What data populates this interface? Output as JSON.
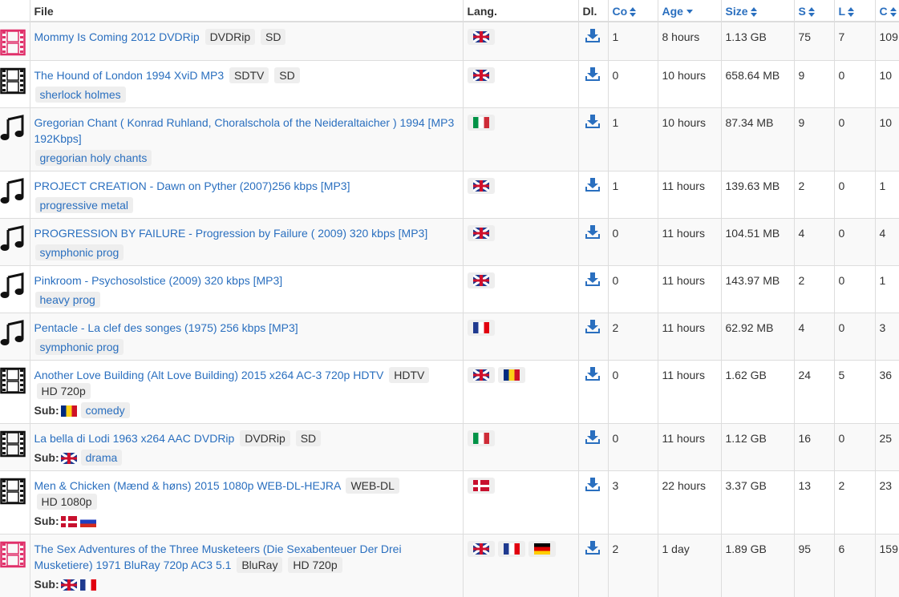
{
  "header": {
    "file": "File",
    "lang": "Lang.",
    "dl": "Dl.",
    "co": "Co",
    "age": "Age",
    "size": "Size",
    "s": "S",
    "l": "L",
    "c": "C"
  },
  "colors": {
    "link": "#2a6fbf",
    "accent_pink": "#e0306a",
    "border": "#dddddd",
    "badge": "#eeeeee"
  },
  "rows": [
    {
      "type": "film-pink",
      "title": "Mommy Is Coming 2012 DVDRip",
      "badges": [
        "DVDRip",
        "SD"
      ],
      "tags": [],
      "sub": [],
      "langs": [
        "uk"
      ],
      "co": "1",
      "age": "8 hours",
      "size": "1.13 GB",
      "s": "75",
      "l": "7",
      "c": "109"
    },
    {
      "type": "film",
      "title": "The Hound of London 1994 XviD MP3",
      "badges": [
        "SDTV",
        "SD"
      ],
      "tags": [
        "sherlock holmes"
      ],
      "sub": [],
      "langs": [
        "uk"
      ],
      "co": "0",
      "age": "10 hours",
      "size": "658.64 MB",
      "s": "9",
      "l": "0",
      "c": "10"
    },
    {
      "type": "music",
      "title": "Gregorian Chant ( Konrad Ruhland, Choralschola of the Neideraltaicher ) 1994 [MP3 192Kbps]",
      "badges": [],
      "tags": [
        "gregorian holy chants"
      ],
      "sub": [],
      "langs": [
        "it"
      ],
      "co": "1",
      "age": "10 hours",
      "size": "87.34 MB",
      "s": "9",
      "l": "0",
      "c": "10"
    },
    {
      "type": "music",
      "title": "PROJECT CREATION - Dawn on Pyther (2007)256 kbps [MP3]",
      "badges": [],
      "tags": [
        "progressive metal"
      ],
      "sub": [],
      "langs": [
        "uk"
      ],
      "co": "1",
      "age": "11 hours",
      "size": "139.63 MB",
      "s": "2",
      "l": "0",
      "c": "1"
    },
    {
      "type": "music",
      "title": "PROGRESSION BY FAILURE - Progression by Failure ( 2009) 320 kbps [MP3]",
      "badges": [],
      "tags": [
        "symphonic prog"
      ],
      "sub": [],
      "langs": [
        "uk"
      ],
      "co": "0",
      "age": "11 hours",
      "size": "104.51 MB",
      "s": "4",
      "l": "0",
      "c": "4"
    },
    {
      "type": "music",
      "title": "Pinkroom - Psychosolstice (2009) 320 kbps [MP3]",
      "badges": [],
      "tags": [
        "heavy prog"
      ],
      "sub": [],
      "langs": [
        "uk"
      ],
      "co": "0",
      "age": "11 hours",
      "size": "143.97 MB",
      "s": "2",
      "l": "0",
      "c": "1"
    },
    {
      "type": "music",
      "title": "Pentacle - La clef des songes (1975) 256 kbps [MP3]",
      "badges": [],
      "tags": [
        "symphonic prog"
      ],
      "sub": [],
      "langs": [
        "fr"
      ],
      "co": "2",
      "age": "11 hours",
      "size": "62.92 MB",
      "s": "4",
      "l": "0",
      "c": "3"
    },
    {
      "type": "film",
      "title": "Another Love Building (Alt Love Building) 2015 x264 AC-3 720p HDTV",
      "badges": [
        "HDTV",
        "HD 720p"
      ],
      "tags": [
        "comedy"
      ],
      "sub": [
        "ro"
      ],
      "langs": [
        "uk",
        "ro"
      ],
      "co": "0",
      "age": "11 hours",
      "size": "1.62 GB",
      "s": "24",
      "l": "5",
      "c": "36"
    },
    {
      "type": "film",
      "title": "La bella di Lodi 1963 x264 AAC DVDRip",
      "badges": [
        "DVDRip",
        "SD"
      ],
      "tags": [
        "drama"
      ],
      "sub": [
        "uk"
      ],
      "langs": [
        "it"
      ],
      "co": "0",
      "age": "11 hours",
      "size": "1.12 GB",
      "s": "16",
      "l": "0",
      "c": "25"
    },
    {
      "type": "film",
      "title": "Men & Chicken (Mænd & høns) 2015 1080p WEB-DL-HEJRA",
      "badges": [
        "WEB-DL",
        "HD 1080p"
      ],
      "tags": [],
      "sub": [
        "dk",
        "ru"
      ],
      "langs": [
        "dk"
      ],
      "co": "3",
      "age": "22 hours",
      "size": "3.37 GB",
      "s": "13",
      "l": "2",
      "c": "23"
    },
    {
      "type": "film-pink",
      "title": "The Sex Adventures of the Three Musketeers (Die Sexabenteuer Der Drei Musketiere) 1971 BluRay 720p AC3 5.1",
      "badges": [
        "BluRay",
        "HD 720p"
      ],
      "tags": [],
      "sub": [
        "uk",
        "fr"
      ],
      "langs": [
        "uk",
        "fr",
        "de"
      ],
      "co": "2",
      "age": "1 day",
      "size": "1.89 GB",
      "s": "95",
      "l": "6",
      "c": "159"
    }
  ],
  "labels": {
    "sub": "Sub:"
  },
  "icons": {
    "film": "film-strip-icon",
    "music": "music-note-icon",
    "download": "download-icon",
    "sort": "sort-icon"
  }
}
